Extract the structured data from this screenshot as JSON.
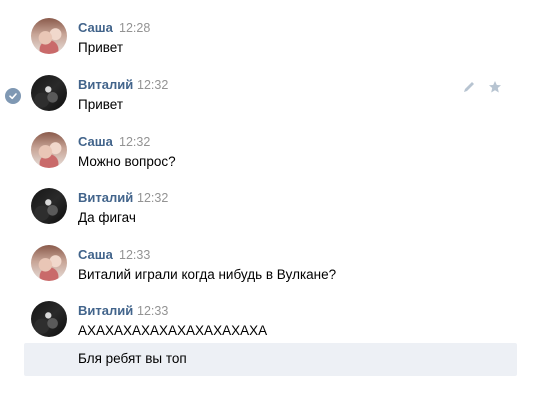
{
  "messages": [
    {
      "author": "Саша",
      "time": "12:28",
      "text": "Привет",
      "avatar": "sasha"
    },
    {
      "author": "Виталий",
      "time": "12:32",
      "text": "Привет",
      "avatar": "vitaliy",
      "selected": true
    },
    {
      "author": "Саша",
      "time": "12:32",
      "text": "Можно вопрос?",
      "avatar": "sasha"
    },
    {
      "author": "Виталий",
      "time": "12:32",
      "text": "Да фигач",
      "avatar": "vitaliy"
    },
    {
      "author": "Саша",
      "time": "12:33",
      "text": "Виталий играли когда нибудь в Вулкане?",
      "avatar": "sasha"
    },
    {
      "author": "Виталий",
      "time": "12:33",
      "text": "АХАХАХАХАХАХАХАХАХАХА",
      "avatar": "vitaliy"
    }
  ],
  "continuation": {
    "text": "Бля ребят вы топ"
  },
  "icons": {
    "selected": "checkmark-icon",
    "edit": "pencil-icon",
    "favorite": "star-icon"
  },
  "colors": {
    "author": "#42648b",
    "time": "#939393",
    "highlight": "#edf0f5",
    "check": "#7f98b3"
  }
}
